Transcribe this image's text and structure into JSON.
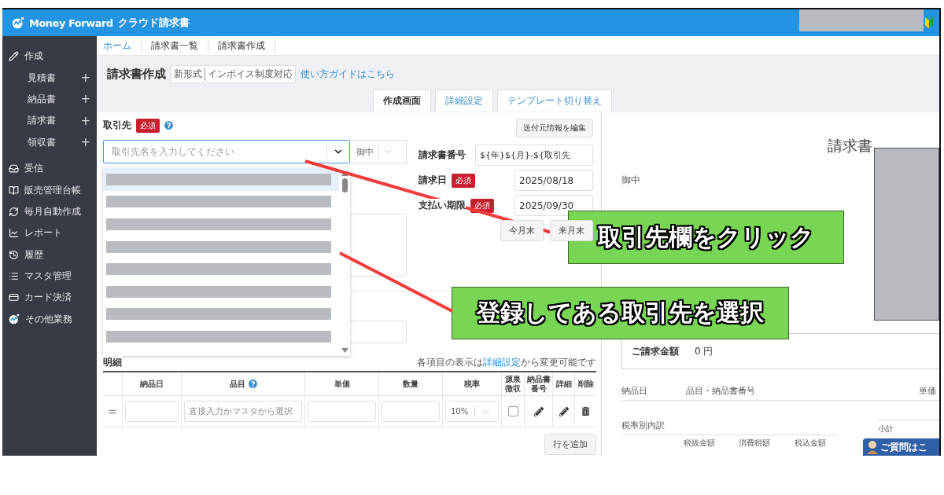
{
  "header": {
    "logo_text": "Money Forward",
    "product": "クラウド請求書"
  },
  "sidebar": {
    "create": {
      "label": "作成",
      "children": [
        {
          "label": "見積書",
          "add": "+"
        },
        {
          "label": "納品書",
          "add": "+"
        },
        {
          "label": "請求書",
          "add": "+"
        },
        {
          "label": "領収書",
          "add": "+"
        }
      ]
    },
    "items": [
      {
        "label": "受信"
      },
      {
        "label": "販売管理台帳"
      },
      {
        "label": "毎月自動作成"
      },
      {
        "label": "レポート"
      },
      {
        "label": "履歴"
      },
      {
        "label": "マスタ管理"
      },
      {
        "label": "カード決済"
      },
      {
        "label": "その他業務"
      }
    ]
  },
  "breadcrumbs": [
    {
      "label": "ホーム",
      "kind": "link"
    },
    {
      "label": "請求書一覧",
      "kind": "text"
    },
    {
      "label": "請求書作成",
      "kind": "text"
    }
  ],
  "page": {
    "title": "請求書作成",
    "badge_parts": [
      "新形式",
      "インボイス制度対応"
    ],
    "guide_link": "使い方ガイドはこちら"
  },
  "tabs": [
    {
      "label": "作成画面",
      "selected": true
    },
    {
      "label": "詳細設定",
      "selected": false
    },
    {
      "label": "テンプレート切り替え",
      "selected": false
    }
  ],
  "form": {
    "client": {
      "label": "取引先",
      "required": "必須",
      "help": true,
      "placeholder": "取引先名を入力してください",
      "expanded": true,
      "honorific": "御中",
      "options": [
        {
          "selected": true
        },
        {
          "selected": false
        },
        {
          "selected": false
        },
        {
          "selected": false
        },
        {
          "selected": false
        },
        {
          "selected": false
        },
        {
          "selected": false
        },
        {
          "selected": false
        }
      ]
    },
    "edit_sender_button": "送付元情報を編集",
    "fields": [
      {
        "label": "請求書番号",
        "value": "${年}${月}-${取引先"
      },
      {
        "label": "請求日",
        "required": "必須",
        "value": "2025/08/18"
      },
      {
        "label": "支払い期限",
        "required": "必須",
        "value": "2025/09/30"
      }
    ],
    "date_buttons": [
      "今月末",
      "来月末"
    ]
  },
  "details": {
    "title": "明細",
    "hint_before": "各項目の表示は",
    "hint_link": "詳細設定",
    "hint_after": "から変更可能です",
    "columns": [
      {
        "label": "納品日",
        "help": false
      },
      {
        "label": "品目",
        "help": true
      },
      {
        "label": "単価",
        "help": false
      },
      {
        "label": "数量",
        "help": false
      },
      {
        "label": "税率",
        "help": false
      },
      {
        "label": "源泉徴収",
        "help": false
      },
      {
        "label": "納品書番号",
        "help": false
      },
      {
        "label": "詳細",
        "help": false
      },
      {
        "label": "削除",
        "help": false
      }
    ],
    "row": {
      "item_placeholder": "直接入力かマスタから選択",
      "tax_rate": "10%",
      "withholding": false
    },
    "add_row_button": "行を追加"
  },
  "preview": {
    "title": "請求書",
    "honorific": "御中",
    "total_label": "ご請求金額",
    "total_value": "0 円",
    "columns": [
      "納品日",
      "品目・納品書番号",
      "単価"
    ],
    "tax_breakdown": {
      "title": "税率別内訳",
      "columns": [
        "税抜金額",
        "消費税額",
        "税込金額"
      ]
    },
    "subtotal": "小計"
  },
  "help_widget": {
    "label": "ご質問はこ"
  },
  "annotations": [
    {
      "text": "取引先欄をクリック"
    },
    {
      "text": "登録してある取引先を選択"
    }
  ]
}
